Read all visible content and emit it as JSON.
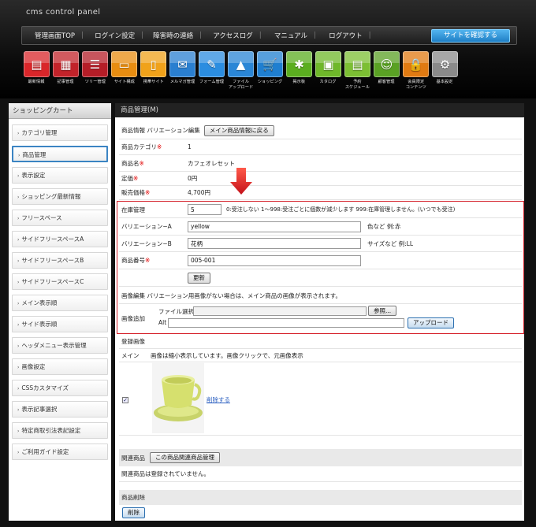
{
  "header": {
    "brand": "cms control panel",
    "nav": [
      "管理画面TOP",
      "ログイン設定",
      "障害時の連絡",
      "アクセスログ",
      "マニュアル",
      "ログアウト"
    ],
    "nav_sep": "|",
    "cta": "サイトを確認する"
  },
  "icons": [
    {
      "label": "最新情報",
      "name": "news-icon",
      "color": "#d9262a",
      "glyph": "▤"
    },
    {
      "label": "記事管理",
      "name": "article-icon",
      "color": "#c2232a",
      "glyph": "▦"
    },
    {
      "label": "ツリー管理",
      "name": "tree-icon",
      "color": "#b51d27",
      "glyph": "☰"
    },
    {
      "label": "サイト構成",
      "name": "site-structure-icon",
      "color": "#e88d11",
      "glyph": "▭"
    },
    {
      "label": "携帯サイト",
      "name": "mobile-site-icon",
      "color": "#f0a21a",
      "glyph": "▯"
    },
    {
      "label": "メルマガ管理",
      "name": "mail-magazine-icon",
      "color": "#2a7fd0",
      "glyph": "✉"
    },
    {
      "label": "フォーム管理",
      "name": "form-icon",
      "color": "#2b8de0",
      "glyph": "✎"
    },
    {
      "label": "ファイル\nアップロード",
      "name": "file-upload-icon",
      "color": "#2a86d6",
      "glyph": "▲"
    },
    {
      "label": "ショッピング",
      "name": "shopping-icon",
      "color": "#1f7fd0",
      "glyph": "🛒"
    },
    {
      "label": "掲示板",
      "name": "bulletin-board-icon",
      "color": "#5bae20",
      "glyph": "✱"
    },
    {
      "label": "カタログ",
      "name": "catalog-icon",
      "color": "#6fb82a",
      "glyph": "▣"
    },
    {
      "label": "予約\nスケジュール",
      "name": "schedule-icon",
      "color": "#7cbf33",
      "glyph": "▤"
    },
    {
      "label": "顧客管理",
      "name": "customer-icon",
      "color": "#5aa124",
      "glyph": "☺"
    },
    {
      "label": "会員限定\nコンテンツ",
      "name": "member-lock-icon",
      "color": "#e07a12",
      "glyph": "🔒"
    },
    {
      "label": "基本設定",
      "name": "settings-gear-icon",
      "color": "#8a8a8a",
      "glyph": "⚙"
    }
  ],
  "sidebar": {
    "title": "ショッピングカート",
    "items": [
      {
        "label": "カテゴリ管理",
        "active": false
      },
      {
        "label": "商品管理",
        "active": true
      },
      {
        "label": "表示設定",
        "active": false
      },
      {
        "label": "ショッピング最新情報",
        "active": false
      },
      {
        "label": "フリースペース",
        "active": false
      },
      {
        "label": "サイドフリースペースA",
        "active": false
      },
      {
        "label": "サイドフリースペースB",
        "active": false
      },
      {
        "label": "サイドフリースペースC",
        "active": false
      },
      {
        "label": "メイン表示順",
        "active": false
      },
      {
        "label": "サイド表示順",
        "active": false
      },
      {
        "label": "ヘッダメニュー表示管理",
        "active": false
      },
      {
        "label": "画像設定",
        "active": false
      },
      {
        "label": "CSSカスタマイズ",
        "active": false
      },
      {
        "label": "表示記事選択",
        "active": false
      },
      {
        "label": "特定商取引法表記設定",
        "active": false
      },
      {
        "label": "ご利用ガイド設定",
        "active": false
      }
    ]
  },
  "main": {
    "title": "商品管理(M)",
    "info_title": "商品情報  バリエーション編集",
    "back_button": "メイン商品情報に戻る",
    "category_label": "商品カテゴリ",
    "category_value": "1",
    "name_label": "商品名",
    "name_value": "カフェオレセット",
    "list_price_label": "定価",
    "list_price_value": "0円",
    "sale_price_label": "販売価格",
    "sale_price_value": "4,700円",
    "required_mark": "※",
    "stock_label": "在庫管理",
    "stock_value": "5",
    "stock_note": "0:受注しない  1〜998:受注ごとに個数が減少します  999:在庫管理しません。(いつでも受注)",
    "var_a_label": "バリエーション−A",
    "var_a_value": "yellow",
    "var_a_note": "色など  例:赤",
    "var_b_label": "バリエーション−B",
    "var_b_value": "花柄",
    "var_b_note": "サイズなど  例:LL",
    "product_no_label": "商品番号",
    "product_no_value": "005-001",
    "update_button": "更新",
    "image_edit_note": "画像編集  バリエーション用画像がない場合は、メイン商品の画像が表示されます。",
    "image_add_label": "画像追加",
    "file_select_label": "ファイル選択",
    "browse_button": "参照...",
    "alt_label": "Alt",
    "upload_button": "アップロード",
    "registered_images_title": "登録画像",
    "main_label": "メイン",
    "image_note": "画像は縮小表示しています。画像クリックで、元画像表示",
    "delete_link": "削除する",
    "related_title": "関連商品",
    "related_button": "この商品関連商品管理",
    "related_note": "関連商品は登録されていません。",
    "delete_section_title": "商品削除",
    "delete_button": "削除"
  }
}
